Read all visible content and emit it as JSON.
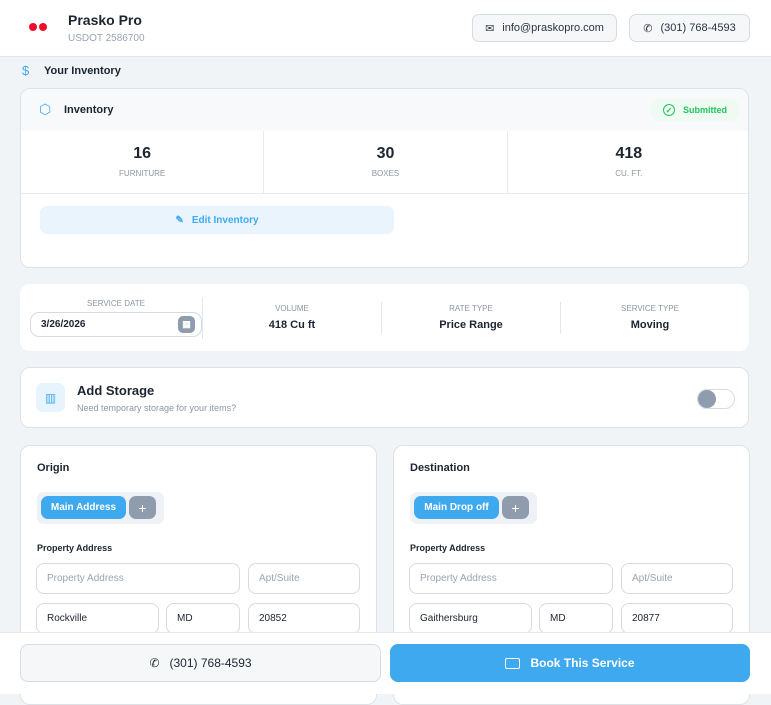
{
  "header": {
    "company": "Prasko Pro",
    "usdot": "USDOT 2586700",
    "email": "info@praskopro.com",
    "phone": "(301) 768-4593"
  },
  "section_title": "Your Inventory",
  "inventory": {
    "title": "Inventory",
    "status": "Submitted",
    "status_color": "#22c55e",
    "stats": [
      {
        "value": "16",
        "label": "FURNITURE"
      },
      {
        "value": "30",
        "label": "BOXES"
      },
      {
        "value": "418",
        "label": "CU. FT."
      }
    ],
    "edit_label": "Edit Inventory"
  },
  "service": {
    "date_label": "SERVICE DATE",
    "date_value": "3/26/2026",
    "volume_label": "VOLUME",
    "volume_value": "418 Cu ft",
    "rate_label": "RATE TYPE",
    "rate_value": "Price Range",
    "type_label": "SERVICE TYPE",
    "type_value": "Moving"
  },
  "storage": {
    "title": "Add Storage",
    "subtitle": "Need temporary storage for your items?",
    "enabled": false
  },
  "origin": {
    "title": "Origin",
    "tab": "Main Address",
    "address_label": "Property Address",
    "address_placeholder": "Property Address",
    "apt_placeholder": "Apt/Suite",
    "city": "Rockville",
    "state": "MD",
    "zip": "20852"
  },
  "destination": {
    "title": "Destination",
    "tab": "Main Drop off",
    "address_label": "Property Address",
    "address_placeholder": "Property Address",
    "apt_placeholder": "Apt/Suite",
    "city": "Gaithersburg",
    "state": "MD",
    "zip": "20877"
  },
  "footer": {
    "phone": "(301) 768-4593",
    "book": "Book This Service"
  },
  "colors": {
    "accent": "#3fa9f0",
    "brand": "#e8102a"
  }
}
